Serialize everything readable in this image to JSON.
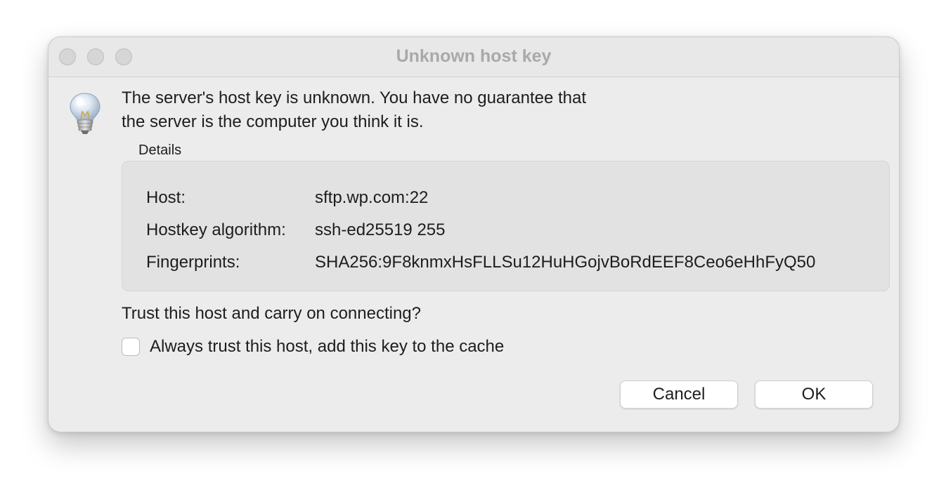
{
  "window": {
    "title": "Unknown host key"
  },
  "icon": {
    "name": "lightbulb-icon"
  },
  "message": {
    "line1": "The server's host key is unknown. You have no guarantee that",
    "line2": "the server is the computer you think it is."
  },
  "details": {
    "label": "Details",
    "rows": [
      {
        "label": "Host:",
        "value": "sftp.wp.com:22"
      },
      {
        "label": "Hostkey algorithm:",
        "value": "ssh-ed25519 255"
      },
      {
        "label": "Fingerprints:",
        "value": "SHA256:9F8knmxHsFLLSu12HuHGojvBoRdEEF8Ceo6eHhFyQ50"
      }
    ]
  },
  "question": "Trust this host and carry on connecting?",
  "checkbox": {
    "label": "Always trust this host, add this key to the cache",
    "checked": false
  },
  "buttons": {
    "cancel": "Cancel",
    "ok": "OK"
  }
}
